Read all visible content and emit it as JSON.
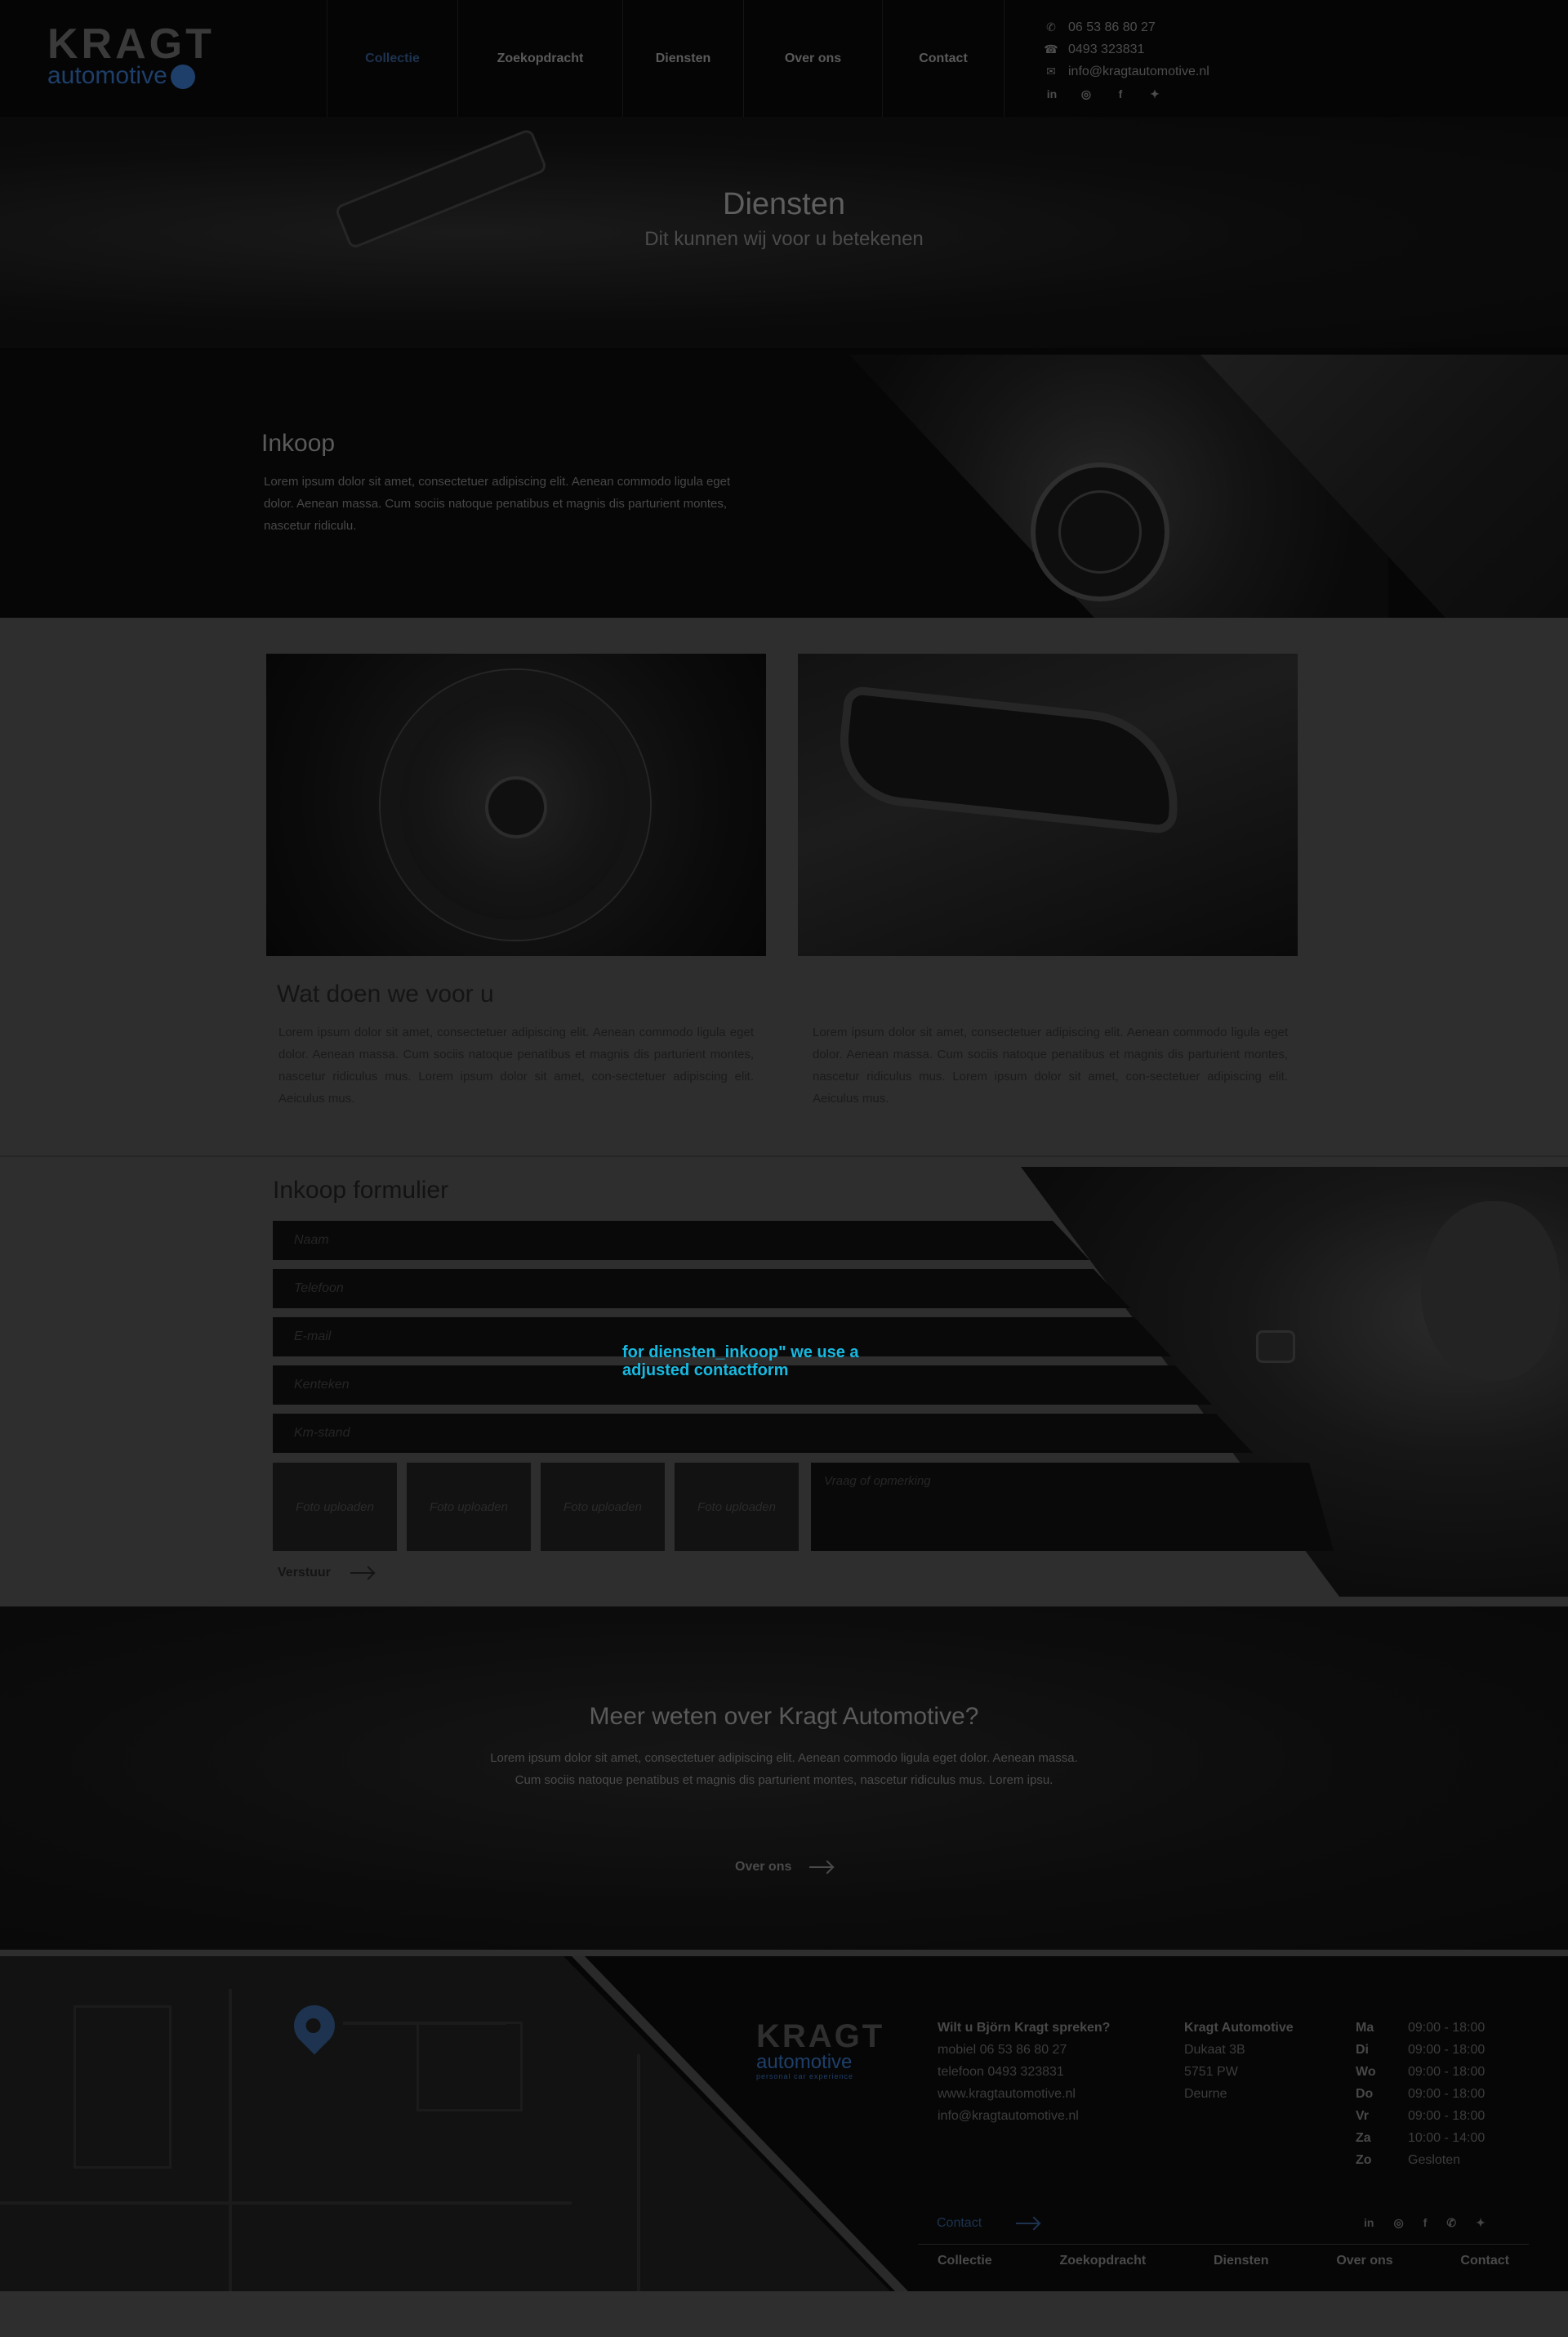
{
  "header": {
    "logo_top": "KRAGT",
    "logo_bottom": "automotive",
    "nav": [
      {
        "label": "Collectie",
        "active": true
      },
      {
        "label": "Zoekopdracht",
        "active": false
      },
      {
        "label": "Diensten",
        "active": false
      },
      {
        "label": "Over ons",
        "active": false
      },
      {
        "label": "Contact",
        "active": false
      }
    ],
    "contact": {
      "whatsapp": "06 53 86 80 27",
      "phone": "0493 323831",
      "email": "info@kragtautomotive.nl"
    },
    "social_icons": [
      "linkedin-icon",
      "instagram-icon",
      "facebook-icon",
      "twitter-icon"
    ],
    "social_glyphs": [
      "in",
      "◎",
      "f",
      "✦"
    ]
  },
  "hero": {
    "title": "Diensten",
    "subtitle": "Dit kunnen wij voor u betekenen"
  },
  "inkoop": {
    "title": "Inkoop",
    "text": "Lorem ipsum dolor sit amet, consectetuer adipiscing elit. Aenean commodo ligula eget dolor. Aenean massa. Cum sociis natoque penatibus et magnis dis parturient montes, nascetur ridiculu."
  },
  "services": {
    "title": "Wat doen we voor u",
    "col1": "Lorem ipsum dolor sit amet, consectetuer adipiscing elit. Aenean commodo ligula eget dolor. Aenean massa. Cum sociis natoque penatibus et magnis dis parturient montes, nascetur ridiculus mus. Lorem ipsum dolor sit amet, con-sectetuer adipiscing elit. Aeiculus mus.",
    "col2": "Lorem ipsum dolor sit amet, consectetuer adipiscing elit. Aenean commodo ligula eget dolor. Aenean massa. Cum sociis natoque penatibus et magnis dis parturient montes, nascetur ridiculus mus. Lorem ipsum dolor sit amet, con-sectetuer adipiscing elit. Aeiculus mus."
  },
  "form": {
    "title": "Inkoop formulier",
    "fields": {
      "naam": "Naam",
      "telefoon": "Telefoon",
      "email": "E-mail",
      "kenteken": "Kenteken",
      "km_stand": "Km-stand"
    },
    "upload_label": "Foto uploaden",
    "vraag_placeholder": "Vraag of opmerking",
    "submit": "Verstuur",
    "annotation": "for diensten_inkoop\" we use a adjusted contactform"
  },
  "meer": {
    "title": "Meer weten over Kragt Automotive?",
    "text": "Lorem ipsum dolor sit amet, consectetuer adipiscing elit. Aenean commodo ligula eget dolor. Aenean massa. Cum sociis natoque penatibus et magnis dis parturient montes, nascetur ridiculus mus. Lorem ipsu.",
    "button": "Over ons"
  },
  "footer": {
    "logo_top": "KRAGT",
    "logo_bottom": "automotive",
    "logo_tag": "personal car experience",
    "speak": {
      "heading": "Wilt u Björn Kragt spreken?",
      "lines": [
        "mobiel 06 53 86 80 27",
        "telefoon 0493 323831",
        "www.kragtautomotive.nl",
        "info@kragtautomotive.nl"
      ]
    },
    "address": {
      "heading": "Kragt Automotive",
      "lines": [
        "Dukaat 3B",
        "5751 PW",
        "Deurne"
      ]
    },
    "hours": [
      {
        "day": "Ma",
        "time": "09:00 - 18:00"
      },
      {
        "day": "Di",
        "time": "09:00 - 18:00"
      },
      {
        "day": "Wo",
        "time": "09:00 - 18:00"
      },
      {
        "day": "Do",
        "time": "09:00 - 18:00"
      },
      {
        "day": "Vr",
        "time": "09:00 - 18:00"
      },
      {
        "day": "Za",
        "time": "10:00 - 14:00"
      },
      {
        "day": "Zo",
        "time": "Gesloten"
      }
    ],
    "contact_button": "Contact",
    "social_icons": [
      "linkedin-icon",
      "instagram-icon",
      "facebook-icon",
      "whatsapp-icon",
      "twitter-icon"
    ],
    "social_glyphs": [
      "in",
      "◎",
      "f",
      "✆",
      "✦"
    ],
    "nav": [
      "Collectie",
      "Zoekopdracht",
      "Diensten",
      "Over ons",
      "Contact"
    ]
  },
  "colors": {
    "accent_blue": "#1d3350",
    "annotation_cyan": "#18b9e0"
  }
}
